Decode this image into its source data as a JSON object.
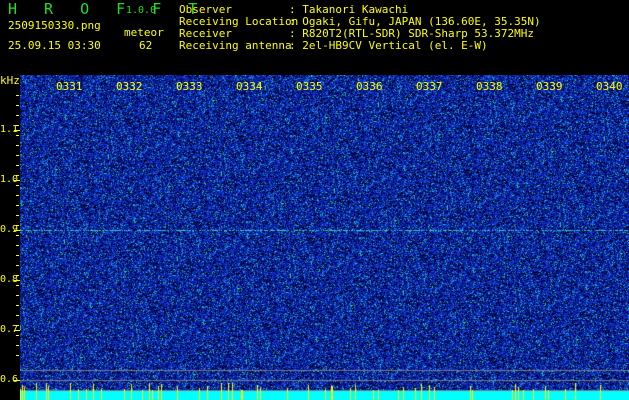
{
  "app": {
    "title": "H R O F F T",
    "version": "1.0.0"
  },
  "file": "2509150330.png",
  "datetime": "25.09.15 03:30",
  "meteor": {
    "label": "meteor",
    "count": "62"
  },
  "info": [
    {
      "label": "Observer",
      "value": ": Takanori Kawachi"
    },
    {
      "label": "Receiving Location",
      "value": ": Ogaki, Gifu, JAPAN (136.60E, 35.35N)"
    },
    {
      "label": "Receiver",
      "value": ": R820T2(RTL-SDR) SDR-Sharp 53.372MHz"
    },
    {
      "label": "Receiving antenna",
      "value": ": 2el-HB9CV Vertical (el. E-W)"
    }
  ],
  "yaxis": {
    "unit": "kHz",
    "ticks": [
      "1.1",
      "1.0",
      "0.9",
      "0.8",
      "0.7",
      "0.6"
    ]
  },
  "time_labels": [
    "0331",
    "0332",
    "0333",
    "0334",
    "0335",
    "0336",
    "0337",
    "0338",
    "0339",
    "0340"
  ],
  "colors": {
    "text": "#ffff00",
    "title": "#22dd22",
    "waterfall_bg": "#0a1a8a",
    "baseline": "#00ffff"
  }
}
